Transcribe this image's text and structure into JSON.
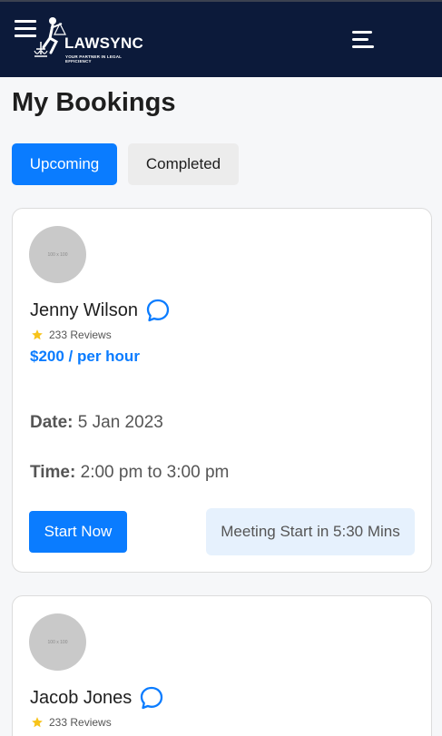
{
  "header": {
    "brand_name": "LAWSYNC",
    "brand_tagline": "YOUR PARTNER IN LEGAL EFFICIENCY"
  },
  "page": {
    "title": "My Bookings"
  },
  "tabs": [
    {
      "label": "Upcoming",
      "active": true
    },
    {
      "label": "Completed",
      "active": false
    }
  ],
  "bookings": [
    {
      "avatar_placeholder": "100 x 100",
      "name": "Jenny Wilson",
      "reviews": "233 Reviews",
      "price": "$200 / per hour",
      "date_label": "Date:",
      "date_value": "5 Jan 2023",
      "time_label": "Time:",
      "time_value": "2:00 pm to 3:00 pm",
      "start_label": "Start Now",
      "meeting_status": "Meeting Start in 5:30 Mins"
    },
    {
      "avatar_placeholder": "100 x 100",
      "name": "Jacob Jones",
      "reviews": "233 Reviews"
    }
  ],
  "colors": {
    "header_bg": "#0c1a3a",
    "accent": "#0a7cff",
    "star": "#f7c31a",
    "badge_bg": "#e6f1fd"
  },
  "icons": [
    "hamburger-menu-icon",
    "menu-icon",
    "chat-bubble-icon",
    "star-icon",
    "lawyer-scales-logo"
  ]
}
